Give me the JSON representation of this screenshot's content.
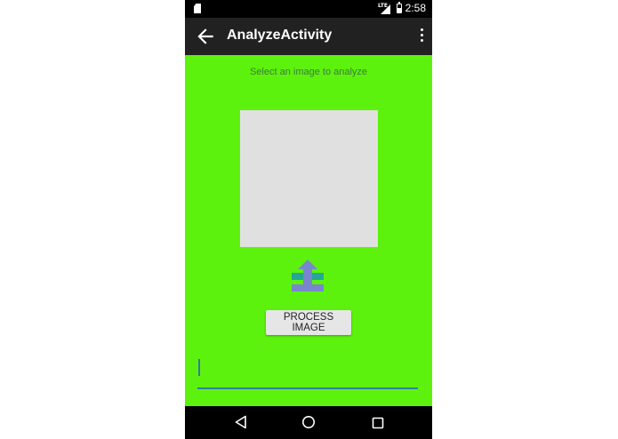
{
  "status_bar": {
    "time": "2:58",
    "network": "LTE",
    "icons": [
      "sd-card-icon",
      "signal-icon",
      "battery-icon"
    ]
  },
  "app_bar": {
    "title": "AnalyzeActivity",
    "back_icon": "arrow-left-icon",
    "overflow_icon": "more-vert-icon"
  },
  "main": {
    "prompt": "Select an image to analyze",
    "upload_icon": "upload-icon",
    "process_button_label": "PROCESS IMAGE",
    "result_field": {
      "value": "",
      "placeholder": ""
    }
  },
  "nav_bar": {
    "icons": [
      "nav-back-icon",
      "nav-home-icon",
      "nav-recents-icon"
    ]
  },
  "colors": {
    "background": "#5df20d",
    "app_bar": "#212121",
    "status_bar": "#000000",
    "image_placeholder": "#e0e0e0",
    "accent": "#2e7fa3",
    "upload_arrow": "#7986cb",
    "upload_base": "#26a69a"
  }
}
